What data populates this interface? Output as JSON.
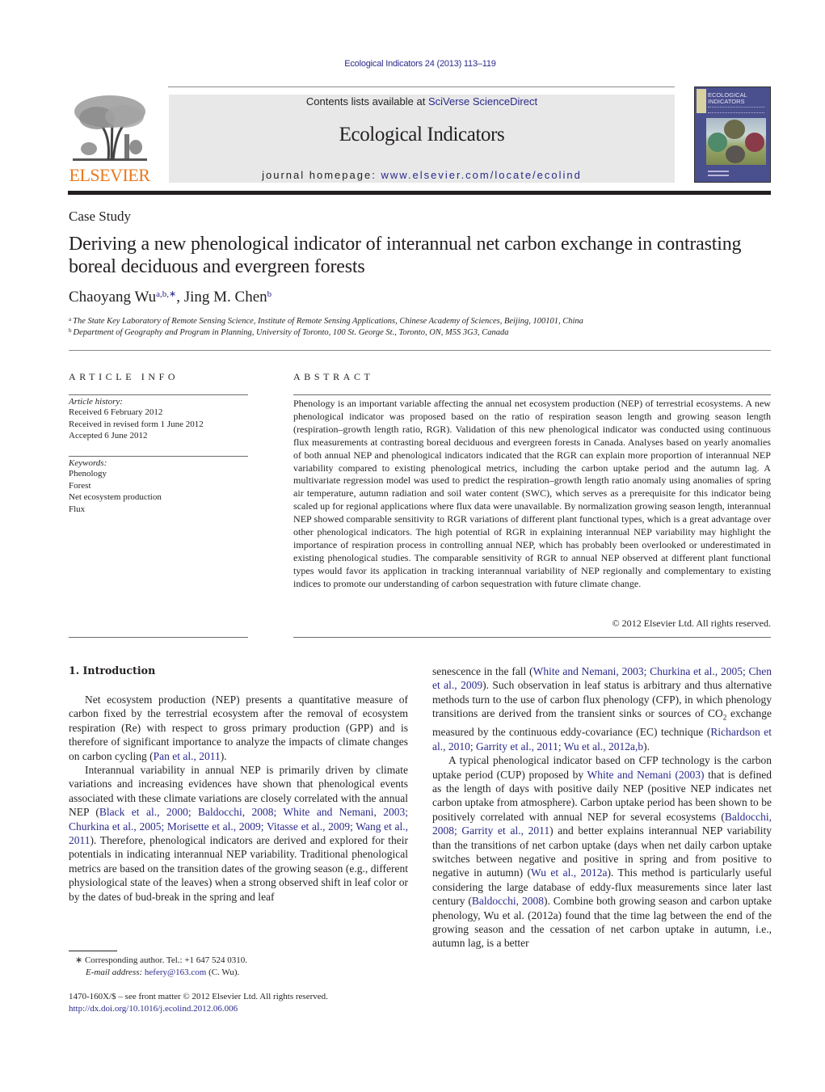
{
  "header": {
    "journal_ref": "Ecological Indicators 24 (2013) 113–119",
    "contents_prefix": "Contents lists available at ",
    "contents_link": "SciVerse ScienceDirect",
    "journal_title": "Ecological Indicators",
    "homepage_prefix": "journal homepage: ",
    "homepage_link": "www.elsevier.com/locate/ecolind",
    "publisher_logo_text": "ELSEVIER",
    "cover_title_line1": "ECOLOGICAL",
    "cover_title_line2": "INDICATORS",
    "colors": {
      "publisher_orange": "#e8781e",
      "link_blue": "#2a2a8a",
      "header_box": "#e8e8e8",
      "cover_purple": "#4a4f8e"
    }
  },
  "article": {
    "type": "Case Study",
    "title": "Deriving a new phenological indicator of interannual net carbon exchange in contrasting boreal deciduous and evergreen forests",
    "authors": [
      {
        "name": "Chaoyang Wu",
        "marks": "a,b,∗",
        "separator": ", "
      },
      {
        "name": "Jing M. Chen",
        "marks": "b",
        "separator": ""
      }
    ],
    "affiliations": [
      {
        "mark": "a",
        "text": "The State Key Laboratory of Remote Sensing Science, Institute of Remote Sensing Applications, Chinese Academy of Sciences, Beijing, 100101, China"
      },
      {
        "mark": "b",
        "text": "Department of Geography and Program in Planning, University of Toronto, 100 St. George St., Toronto, ON, M5S 3G3, Canada"
      }
    ]
  },
  "article_info": {
    "heading": "ARTICLE INFO",
    "history_label": "Article history:",
    "history": [
      "Received 6 February 2012",
      "Received in revised form 1 June 2012",
      "Accepted 6 June 2012"
    ],
    "keywords_label": "Keywords:",
    "keywords": [
      "Phenology",
      "Forest",
      "Net ecosystem production",
      "Flux"
    ]
  },
  "abstract": {
    "heading": "ABSTRACT",
    "text": "Phenology is an important variable affecting the annual net ecosystem production (NEP) of terrestrial ecosystems. A new phenological indicator was proposed based on the ratio of respiration season length and growing season length (respiration–growth length ratio, RGR). Validation of this new phenological indicator was conducted using continuous flux measurements at contrasting boreal deciduous and evergreen forests in Canada. Analyses based on yearly anomalies of both annual NEP and phenological indicators indicated that the RGR can explain more proportion of interannual NEP variability compared to existing phenological metrics, including the carbon uptake period and the autumn lag. A multivariate regression model was used to predict the respiration–growth length ratio anomaly using anomalies of spring air temperature, autumn radiation and soil water content (SWC), which serves as a prerequisite for this indicator being scaled up for regional applications where flux data were unavailable. By normalization growing season length, interannual NEP showed comparable sensitivity to RGR variations of different plant functional types, which is a great advantage over other phenological indicators. The high potential of RGR in explaining interannual NEP variability may highlight the importance of respiration process in controlling annual NEP, which has probably been overlooked or underestimated in existing phenological studies. The comparable sensitivity of RGR to annual NEP observed at different plant functional types would favor its application in tracking interannual variability of NEP regionally and complementary to existing indices to promote our understanding of carbon sequestration with future climate change.",
    "copyright": "© 2012 Elsevier Ltd. All rights reserved."
  },
  "body": {
    "section_heading": "1.  Introduction",
    "left": {
      "p1": "Net ecosystem production (NEP) presents a quantitative measure of carbon fixed by the terrestrial ecosystem after the removal of ecosystem respiration (Re) with respect to gross primary production (GPP) and is therefore of significant importance to analyze the impacts of climate changes on carbon cycling (",
      "p1_cite": "Pan et al., 2011",
      "p1_end": ").",
      "p2_a": "Interannual variability in annual NEP is primarily driven by climate variations and increasing evidences have shown that phenological events associated with these climate variations are closely correlated with the annual NEP (",
      "p2_cite": "Black et al., 2000; Baldocchi, 2008; White and Nemani, 2003; Churkina et al., 2005; Morisette et al., 2009; Vitasse et al., 2009; Wang et al., 2011",
      "p2_b": "). Therefore, phenological indicators are derived and explored for their potentials in indicating interannual NEP variability. Traditional phenological metrics are based on the transition dates of the growing season (e.g., different physiological state of the leaves) when a strong observed shift in leaf color or by the dates of bud-break in the spring and leaf"
    },
    "right": {
      "p1_a": "senescence in the fall (",
      "p1_cite1": "White and Nemani, 2003; Churkina et al., 2005; Chen et al., 2009",
      "p1_b": "). Such observation in leaf status is arbitrary and thus alternative methods turn to the use of carbon flux phenology (CFP), in which phenology transitions are derived from the transient sinks or sources of CO",
      "p1_sub": "2",
      "p1_c": " exchange measured by the continuous eddy-covariance (EC) technique (",
      "p1_cite2": "Richardson et al., 2010; Garrity et al., 2011; Wu et al., 2012a,b",
      "p1_d": ").",
      "p2_a": "A typical phenological indicator based on CFP technology is the carbon uptake period (CUP) proposed by ",
      "p2_cite1": "White and Nemani (2003)",
      "p2_b": " that is defined as the length of days with positive daily NEP (positive NEP indicates net carbon uptake from atmosphere). Carbon uptake period has been shown to be positively correlated with annual NEP for several ecosystems (",
      "p2_cite2": "Baldocchi, 2008; Garrity et al., 2011",
      "p2_c": ") and better explains interannual NEP variability than the transitions of net carbon uptake (days when net daily carbon uptake switches between negative and positive in spring and from positive to negative in autumn) (",
      "p2_cite3": "Wu et al., 2012a",
      "p2_d": "). This method is particularly useful considering the large database of eddy-flux measurements since later last century (",
      "p2_cite4": "Baldocchi, 2008",
      "p2_e": "). Combine both growing season and carbon uptake phenology, Wu et al. (2012a) found that the time lag between the end of the growing season and the cessation of net carbon uptake in autumn, i.e., autumn lag, is a better"
    }
  },
  "footnotes": {
    "corresponding": "∗  Corresponding author. Tel.: +1 647 524 0310.",
    "email_label": "E-mail address: ",
    "email": "hefery@163.com",
    "email_suffix": " (C. Wu).",
    "issn_line": "1470-160X/$ – see front matter © 2012 Elsevier Ltd. All rights reserved.",
    "doi": "http://dx.doi.org/10.1016/j.ecolind.2012.06.006"
  }
}
